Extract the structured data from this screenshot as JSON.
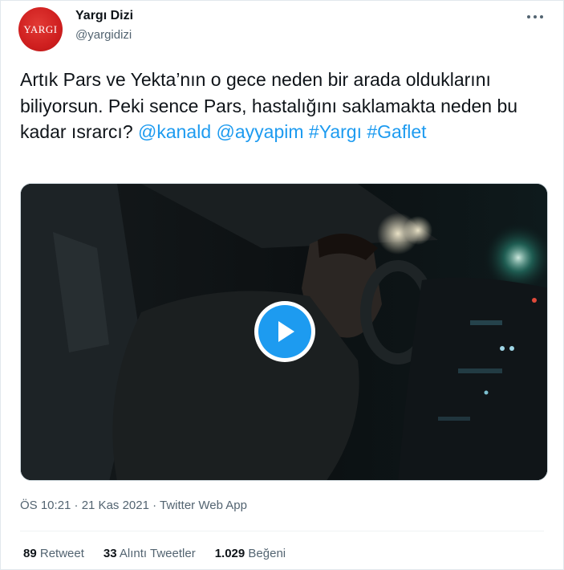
{
  "author": {
    "avatar_text": "YARGI",
    "name": "Yargı Dizi",
    "handle": "@yargidizi"
  },
  "tweet": {
    "text": "Artık Pars ve Yekta’nın o gece neden bir arada olduklarını biliyorsun. Peki sence Pars, hastalığını saklamakta neden bu kadar ısrarcı?",
    "mentions": [
      "@kanald",
      "@ayyapim"
    ],
    "hashtags": [
      "#Yargı",
      "#Gaflet"
    ],
    "timestamp": "ÖS 10:21 · 21 Kas 2021 · Twitter Web App"
  },
  "stats": {
    "retweets_count": "89",
    "retweets_label": "Retweet",
    "quotes_count": "33",
    "quotes_label": "Alıntı Tweetler",
    "likes_count": "1.029",
    "likes_label": "Beğeni"
  },
  "icons": {
    "more": "more-horizontal-icon",
    "play": "play-icon"
  },
  "colors": {
    "link": "#1d9bf0",
    "play_button": "#1d9bf0",
    "avatar": "#d32020"
  }
}
